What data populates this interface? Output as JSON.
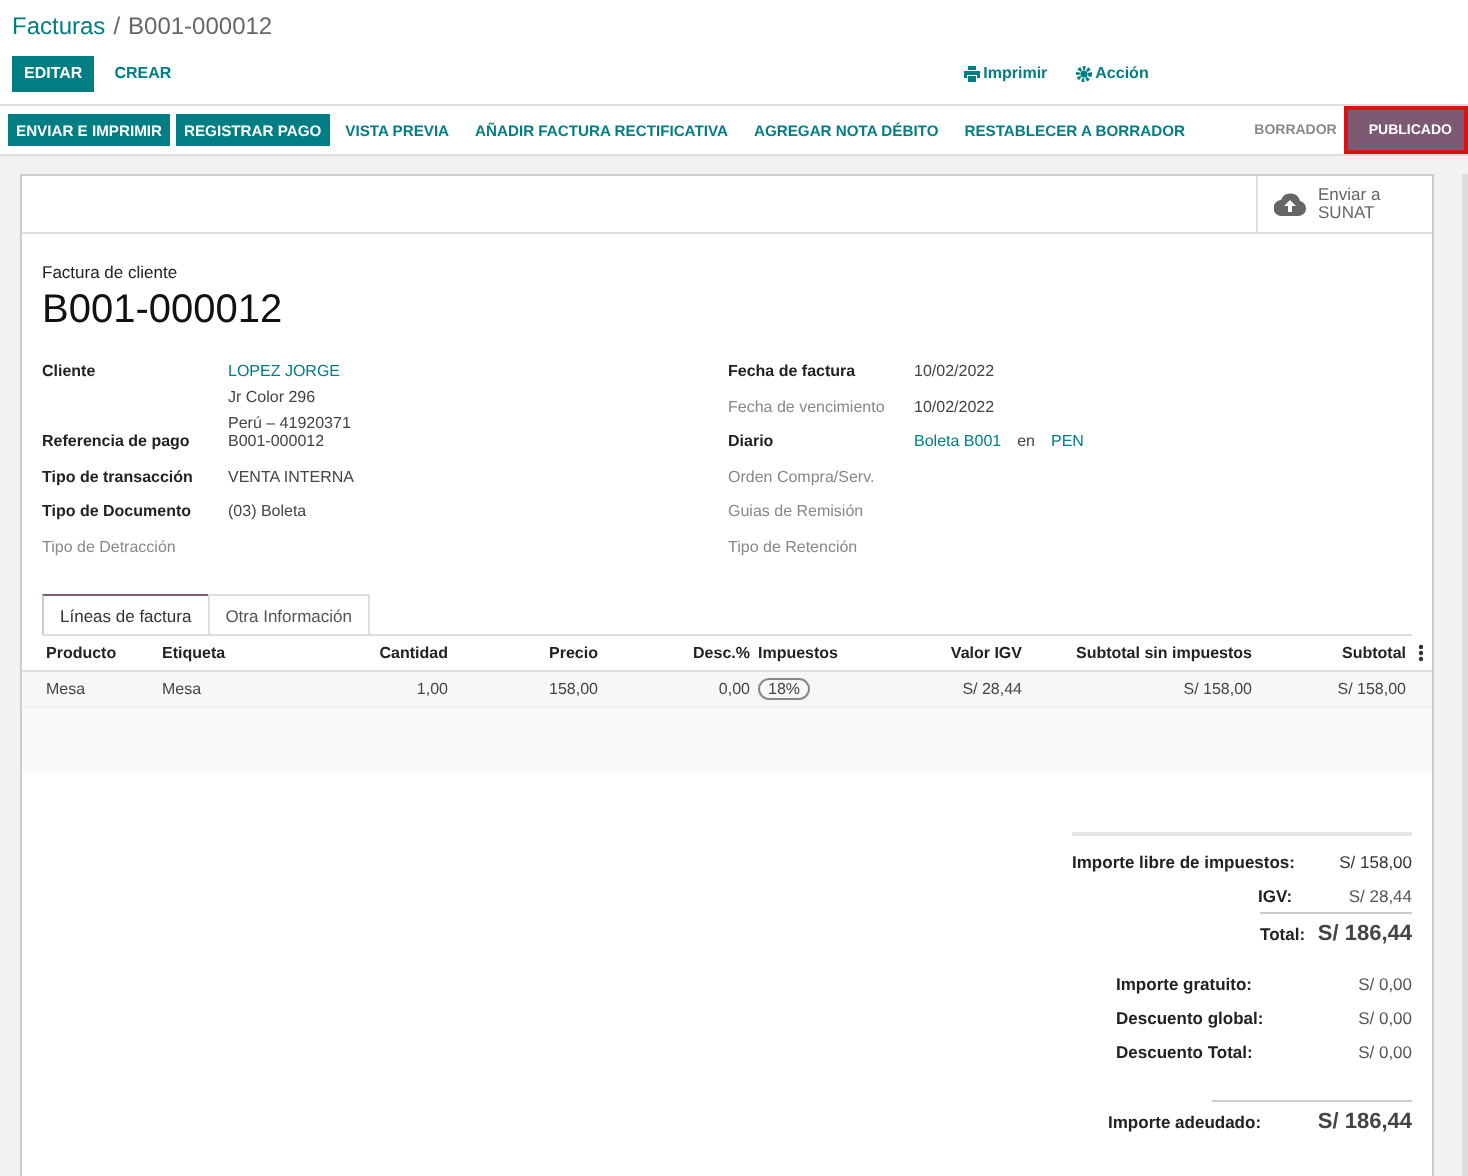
{
  "breadcrumb": {
    "parent": "Facturas",
    "separator": "/",
    "current": "B001-000012"
  },
  "buttons": [
    {
      "label": "EDITAR",
      "kind": "primary"
    },
    {
      "label": "CREAR",
      "kind": "link"
    }
  ],
  "actions": [
    {
      "label": "Imprimir",
      "kind": "print"
    },
    {
      "label": "Acción",
      "kind": "gear"
    }
  ],
  "statusbar": {
    "buttons": [
      {
        "label": "ENVIAR E IMPRIMIR",
        "kind": "primary"
      },
      {
        "label": "REGISTRAR PAGO",
        "kind": "primary"
      },
      {
        "label": "VISTA PREVIA",
        "kind": "link"
      },
      {
        "label": "AÑADIR FACTURA RECTIFICATIVA",
        "kind": "link"
      },
      {
        "label": "AGREGAR NOTA DÉBITO",
        "kind": "link"
      },
      {
        "label": "RESTABLECER A BORRADOR",
        "kind": "link"
      }
    ],
    "stages": [
      {
        "label": "BORRADOR",
        "selected": false,
        "highlighted": false
      },
      {
        "label": "PUBLICADO",
        "selected": true,
        "highlighted": true
      }
    ]
  },
  "sunat_button": {
    "label": "Enviar a SUNAT"
  },
  "form": {
    "subtitle": "Factura de cliente",
    "title": "B001-000012",
    "left_fields": [
      {
        "label": "Cliente",
        "kind": "filled",
        "values": [
          {
            "text": "LOPEZ JORGE",
            "link": true
          },
          {
            "text": "Jr Color 296",
            "link": false
          },
          {
            "text": "Perú – 41920371",
            "link": false
          }
        ]
      },
      {
        "label": "Referencia de pago",
        "kind": "filled",
        "values": [
          {
            "text": "B001-000012",
            "link": false
          }
        ]
      },
      {
        "label": "Tipo de transacción",
        "kind": "filled",
        "values": [
          {
            "text": "VENTA INTERNA",
            "link": false
          }
        ]
      },
      {
        "label": "Tipo de Documento",
        "kind": "filled",
        "values": [
          {
            "text": "(03) Boleta",
            "link": false
          }
        ]
      },
      {
        "label": "Tipo de Detracción",
        "kind": "optional"
      }
    ],
    "right_fields": [
      {
        "label": "Fecha de factura",
        "kind": "filled",
        "values": [
          {
            "text": "10/02/2022",
            "link": false
          }
        ]
      },
      {
        "label": "Fecha de vencimiento",
        "kind": "optional",
        "values": [
          {
            "text": "10/02/2022",
            "link": false
          }
        ]
      },
      {
        "label": "Diario",
        "kind": "inline",
        "values": [
          {
            "text": "Boleta B001",
            "link": true
          },
          {
            "text": "en",
            "link": false
          },
          {
            "text": "PEN",
            "link": true
          }
        ]
      },
      {
        "label": "Orden Compra/Serv.",
        "kind": "optional"
      },
      {
        "label": "Guias de Remisión",
        "kind": "optional"
      },
      {
        "label": "Tipo de Retención",
        "kind": "optional"
      }
    ]
  },
  "tabs": [
    {
      "label": "Líneas de factura",
      "selected": true
    },
    {
      "label": "Otra Información",
      "selected": false
    }
  ],
  "table": {
    "columns": [
      "Producto",
      "Etiqueta",
      "Cantidad",
      "Precio",
      "Desc.%",
      "Impuestos",
      "Valor IGV",
      "Subtotal sin impuestos",
      "Subtotal"
    ],
    "rows": [
      {
        "cells": [
          {
            "text": "Mesa",
            "kind": "text"
          },
          {
            "text": "Mesa",
            "kind": "text"
          },
          {
            "text": "1,00",
            "kind": "text"
          },
          {
            "text": "158,00",
            "kind": "text"
          },
          {
            "text": "0,00",
            "kind": "text"
          },
          {
            "text": "18%",
            "kind": "tag"
          },
          {
            "text": "S/ 28,44",
            "kind": "text"
          },
          {
            "text": "S/ 158,00",
            "kind": "text"
          },
          {
            "text": "S/ 158,00",
            "kind": "text"
          }
        ]
      }
    ]
  },
  "totals": [
    {
      "label": "Importe libre de impuestos:",
      "value": "S/ 158,00",
      "kind": "subtotal"
    },
    {
      "label": "IGV:",
      "value": "S/ 28,44",
      "kind": "tax"
    },
    {
      "label": "Total:",
      "value": "S/ 186,44",
      "kind": "total"
    },
    {
      "label": "Importe gratuito:",
      "value": "S/ 0,00",
      "kind": "detail"
    },
    {
      "label": "Descuento global:",
      "value": "S/ 0,00",
      "kind": "detail"
    },
    {
      "label": "Descuento Total:",
      "value": "S/ 0,00",
      "kind": "detail"
    },
    {
      "label": "Importe adeudado:",
      "value": "S/ 186,44",
      "kind": "due"
    }
  ]
}
